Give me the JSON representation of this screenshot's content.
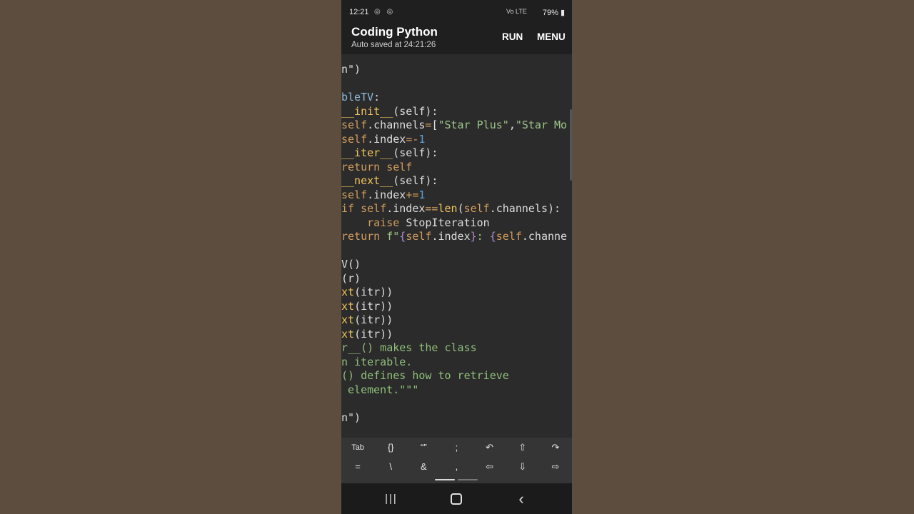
{
  "statusbar": {
    "time": "12:21",
    "icons_left": "◎ ◎",
    "network": "Vo LTE",
    "battery": "79%"
  },
  "appbar": {
    "title": "Coding Python",
    "subtitle": "Auto saved at 24:21:26",
    "run": "RUN",
    "menu": "MENU"
  },
  "code_lines": [
    [
      {
        "t": "n\")",
        "c": "c-plain"
      }
    ],
    [],
    [
      {
        "t": "bleTV",
        "c": "c-class"
      },
      {
        "t": ":",
        "c": "c-plain"
      }
    ],
    [
      {
        "t": "__init__",
        "c": "c-func"
      },
      {
        "t": "(self):",
        "c": "c-plain"
      }
    ],
    [
      {
        "t": "self",
        "c": "c-self"
      },
      {
        "t": ".channels",
        "c": "c-plain"
      },
      {
        "t": "=",
        "c": "c-op"
      },
      {
        "t": "[",
        "c": "c-plain"
      },
      {
        "t": "\"Star Plus\"",
        "c": "c-string"
      },
      {
        "t": ",",
        "c": "c-plain"
      },
      {
        "t": "\"Star Mo",
        "c": "c-string"
      }
    ],
    [
      {
        "t": "self",
        "c": "c-self"
      },
      {
        "t": ".index",
        "c": "c-plain"
      },
      {
        "t": "=-",
        "c": "c-op"
      },
      {
        "t": "1",
        "c": "c-num"
      }
    ],
    [
      {
        "t": "__iter__",
        "c": "c-func"
      },
      {
        "t": "(self):",
        "c": "c-plain"
      }
    ],
    [
      {
        "t": "return self",
        "c": "c-kw"
      }
    ],
    [
      {
        "t": "__next__",
        "c": "c-func"
      },
      {
        "t": "(self):",
        "c": "c-plain"
      }
    ],
    [
      {
        "t": "self",
        "c": "c-self"
      },
      {
        "t": ".index",
        "c": "c-plain"
      },
      {
        "t": "+=",
        "c": "c-op"
      },
      {
        "t": "1",
        "c": "c-num"
      }
    ],
    [
      {
        "t": "if ",
        "c": "c-kw"
      },
      {
        "t": "self",
        "c": "c-self"
      },
      {
        "t": ".index",
        "c": "c-plain"
      },
      {
        "t": "==",
        "c": "c-op"
      },
      {
        "t": "len",
        "c": "c-builtin"
      },
      {
        "t": "(",
        "c": "c-plain"
      },
      {
        "t": "self",
        "c": "c-self"
      },
      {
        "t": ".channels):",
        "c": "c-plain"
      }
    ],
    [
      {
        "t": "    raise ",
        "c": "c-kw"
      },
      {
        "t": "StopIteration",
        "c": "c-plain"
      }
    ],
    [
      {
        "t": "return ",
        "c": "c-kw"
      },
      {
        "t": "f\"",
        "c": "c-string"
      },
      {
        "t": "{",
        "c": "c-brace"
      },
      {
        "t": "self",
        "c": "c-self"
      },
      {
        "t": ".index",
        "c": "c-plain"
      },
      {
        "t": "}",
        "c": "c-brace"
      },
      {
        "t": ": ",
        "c": "c-string"
      },
      {
        "t": "{",
        "c": "c-brace"
      },
      {
        "t": "self",
        "c": "c-self"
      },
      {
        "t": ".channe",
        "c": "c-plain"
      }
    ],
    [],
    [
      {
        "t": "V()",
        "c": "c-plain"
      }
    ],
    [
      {
        "t": "(r)",
        "c": "c-plain"
      }
    ],
    [
      {
        "t": "xt",
        "c": "c-builtin"
      },
      {
        "t": "(itr))",
        "c": "c-plain"
      }
    ],
    [
      {
        "t": "xt",
        "c": "c-builtin"
      },
      {
        "t": "(itr))",
        "c": "c-plain"
      }
    ],
    [
      {
        "t": "xt",
        "c": "c-builtin"
      },
      {
        "t": "(itr))",
        "c": "c-plain"
      }
    ],
    [
      {
        "t": "xt",
        "c": "c-builtin"
      },
      {
        "t": "(itr))",
        "c": "c-plain"
      }
    ],
    [
      {
        "t": "r__() makes the class",
        "c": "c-comment"
      }
    ],
    [
      {
        "t": "n iterable.",
        "c": "c-comment"
      }
    ],
    [
      {
        "t": "() defines how to retrieve",
        "c": "c-comment"
      }
    ],
    [
      {
        "t": " element.\"\"\"",
        "c": "c-comment"
      }
    ],
    [],
    [
      {
        "t": "n\")",
        "c": "c-plain"
      }
    ]
  ],
  "keyboard": {
    "row1": [
      {
        "label": "Tab",
        "name": "tab-key"
      },
      {
        "label": "{}",
        "name": "braces-key"
      },
      {
        "label": "“”",
        "name": "quotes-key"
      },
      {
        "label": ";",
        "name": "semicolon-key"
      },
      {
        "label": "↶",
        "name": "undo-key"
      },
      {
        "label": "⇧",
        "name": "shift-key"
      },
      {
        "label": "↷",
        "name": "redo-key"
      }
    ],
    "row2": [
      {
        "label": "=",
        "name": "equals-key"
      },
      {
        "label": "\\",
        "name": "backslash-key"
      },
      {
        "label": "&",
        "name": "ampersand-key"
      },
      {
        "label": ",",
        "name": "comma-key"
      },
      {
        "label": "⇦",
        "name": "arrow-left-key"
      },
      {
        "label": "⇩",
        "name": "arrow-down-key"
      },
      {
        "label": "⇨",
        "name": "arrow-right-key"
      }
    ]
  },
  "navbar": {
    "recents_icon": "recents-icon",
    "home_icon": "home-icon",
    "back_icon": "back-icon"
  },
  "colors": {
    "background": "#5d4d3e",
    "editor": "#2b2b2b",
    "bars": "#1f1f1f"
  }
}
